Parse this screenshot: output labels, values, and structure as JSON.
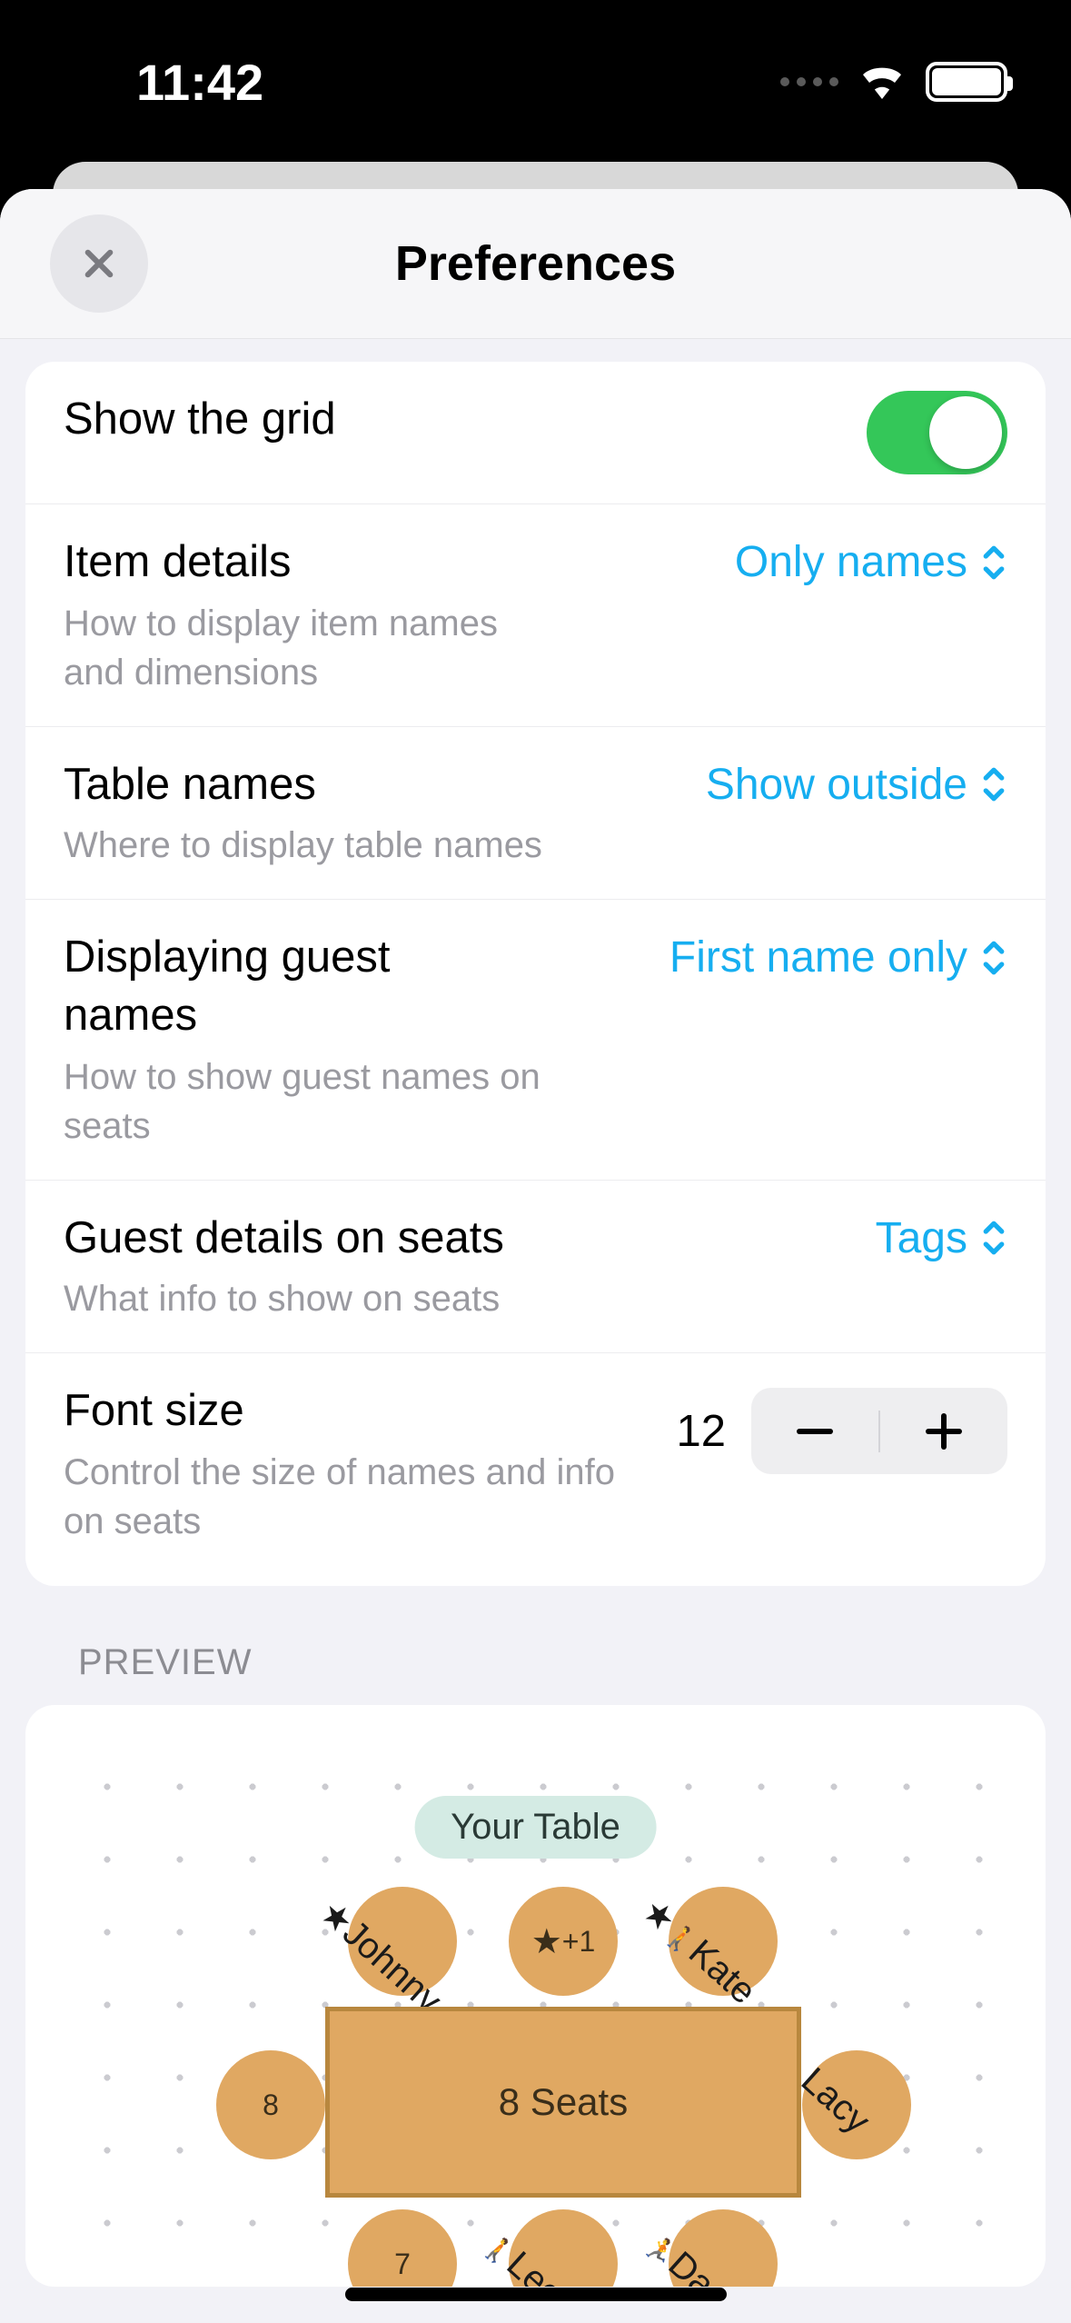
{
  "status": {
    "time": "11:42"
  },
  "header": {
    "title": "Preferences"
  },
  "rows": {
    "grid": {
      "title": "Show the grid",
      "enabled": true
    },
    "itemDetails": {
      "title": "Item details",
      "sub": "How to display item names and dimensions",
      "value": "Only names"
    },
    "tableNames": {
      "title": "Table names",
      "sub": "Where to display table names",
      "value": "Show outside"
    },
    "guestNames": {
      "title": "Displaying guest names",
      "sub": "How to show guest names on seats",
      "value": "First name only"
    },
    "guestDetails": {
      "title": "Guest details on seats",
      "sub": "What info to show on seats",
      "value": "Tags"
    },
    "fontSize": {
      "title": "Font size",
      "sub": "Control the size of names and info on seats",
      "value": "12"
    }
  },
  "preview": {
    "section": "PREVIEW",
    "tableName": "Your Table",
    "tableSeats": "8 Seats",
    "seats": {
      "left": "8",
      "bottomLeft": "7",
      "johnny": "Johnny",
      "plusOne": "+1",
      "kate": "Kate",
      "lacy": "Lacy",
      "lee": "Lee",
      "da": "Da"
    }
  }
}
